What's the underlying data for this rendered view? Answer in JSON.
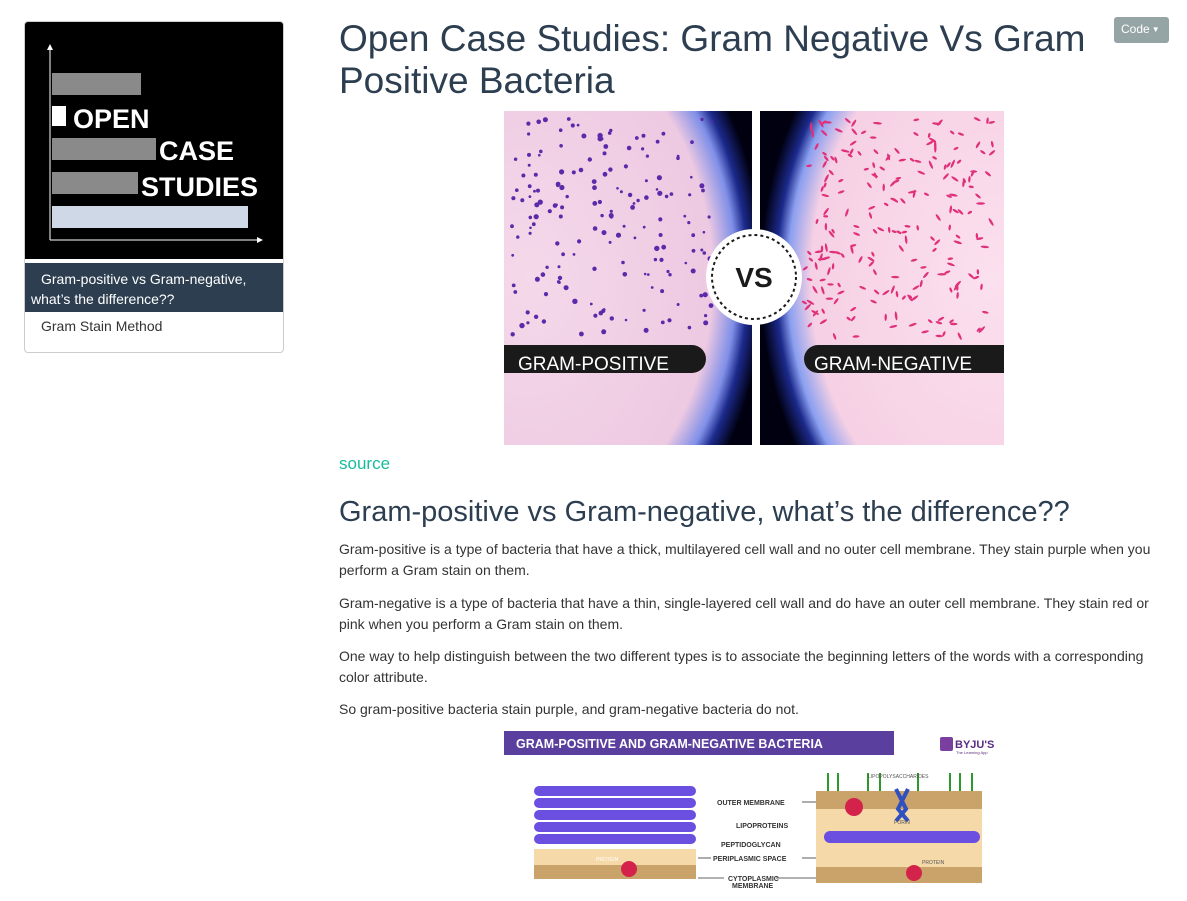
{
  "toc": {
    "logo": {
      "line1": "OPEN",
      "line2": "CASE",
      "line3": "STUDIES",
      "colors": {
        "background": "#000000",
        "bar_grey": "#8a8a8a",
        "bar_light": "#cfd8e6"
      }
    },
    "items": [
      {
        "label_line1": "Gram-positive vs Gram-negative,",
        "label_line2": "what’s the difference??",
        "active": true
      },
      {
        "label": "Gram Stain Method",
        "active": false
      }
    ]
  },
  "code_button": {
    "label": "Code",
    "icon": "caret-down-icon"
  },
  "title": "Open Case Studies: Gram Negative Vs Gram Positive Bacteria",
  "hero_image": {
    "left_label": "GRAM-POSITIVE",
    "right_label": "GRAM-NEGATIVE",
    "center_label": "VS"
  },
  "source_link": "source",
  "section_heading": "Gram-positive vs Gram-negative, what’s the difference??",
  "paragraphs": [
    "Gram-positive is a type of bacteria that have a thick, multilayered cell wall and no outer cell membrane. They stain purple when you perform a Gram stain on them.",
    "Gram-negative is a type of bacteria that have a thin, single-layered cell wall and do have an outer cell membrane. They stain red or pink when you perform a Gram stain on them.",
    "One way to help distinguish between the two different types is to associate the beginning letters of the words with a corresponding color attribute.",
    "So gram-positive bacteria stain purple, and gram-negative bacteria do not."
  ],
  "diagram": {
    "banner": "GRAM-POSITIVE AND GRAM-NEGATIVE BACTERIA",
    "brand": "BYJU'S",
    "brand_sub": "The Learning App",
    "labels": {
      "lipopolysaccharides": "LIPOPOLYSACCHARIDES",
      "outer_membrane": "OUTER MEMBRANE",
      "porin": "PORIN",
      "lipoproteins": "LIPOPROTEINS",
      "peptidoglycan": "PEPTIDOGLYCAN",
      "periplasmic_space": "PERIPLASMIC SPACE",
      "protein_left": "PROTEIN",
      "protein_right": "PROTEIN",
      "cytoplasmic_line1": "CYTOPLASMIC",
      "cytoplasmic_line2": "MEMBRANE"
    },
    "colors": {
      "banner": "#5a3f9e",
      "peptidoglycan": "#6a4fe0",
      "membrane": "#c9a36a",
      "protein": "#d4234a",
      "space": "#f6d9a8"
    }
  }
}
